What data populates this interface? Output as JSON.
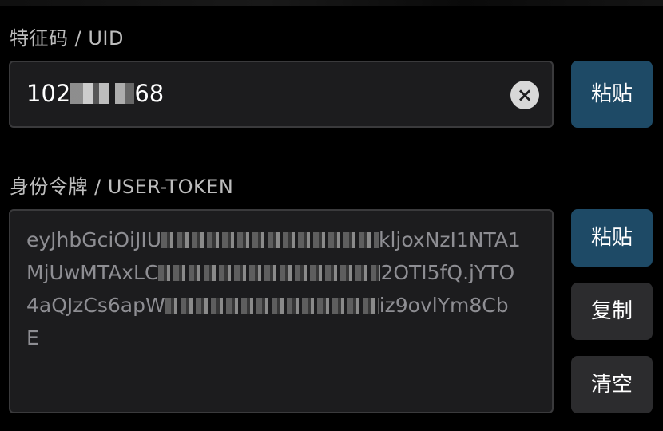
{
  "uid": {
    "label": "特征码 / UID",
    "value_prefix": "102",
    "value_suffix": "68",
    "paste_label": "粘贴"
  },
  "token": {
    "label": "身份令牌 / USER-TOKEN",
    "line1_start": "eyJhbGciOiJIU",
    "line1_end": "kljoxNzI1NTA1",
    "line2_start": "MjUwMTAxLC",
    "line2_end": "2OTI5fQ.jYTO",
    "line3_start": "4aQJzCs6apW",
    "line3_end": "iz9ovlYm8Cb",
    "line4": "E",
    "paste_label": "粘贴",
    "copy_label": "复制",
    "clear_label": "清空"
  }
}
